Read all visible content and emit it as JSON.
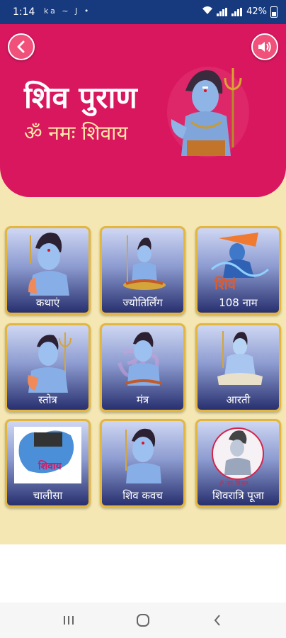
{
  "status_bar": {
    "time": "1:14",
    "notifications": "ka ~ J •",
    "battery": "42%"
  },
  "header": {
    "title": "शिव पुराण",
    "subtitle": "ॐ नमः शिवाय",
    "accent_color": "#d8175f",
    "back_icon": "chevron-left-icon",
    "sound_icon": "speaker-icon"
  },
  "grid": {
    "items": [
      {
        "label": "कथाएं",
        "icon": "shiva-blessing-image"
      },
      {
        "label": "ज्योतिर्लिंग",
        "icon": "shiva-meditating-image"
      },
      {
        "label": "108 नाम",
        "icon": "shiva-dancing-image"
      },
      {
        "label": "स्तोत्र",
        "icon": "shiva-trishul-image"
      },
      {
        "label": "मंत्र",
        "icon": "shiva-om-image"
      },
      {
        "label": "आरती",
        "icon": "shiva-seated-image"
      },
      {
        "label": "चालीसा",
        "icon": "chalisa-art-image"
      },
      {
        "label": "शिव कवच",
        "icon": "shiva-portrait-image"
      },
      {
        "label": "शिवरात्रि पूजा",
        "icon": "shivratri-art-image"
      }
    ]
  },
  "nav": {
    "recents_icon": "recents-icon",
    "home_icon": "home-icon",
    "back_icon": "back-icon"
  }
}
